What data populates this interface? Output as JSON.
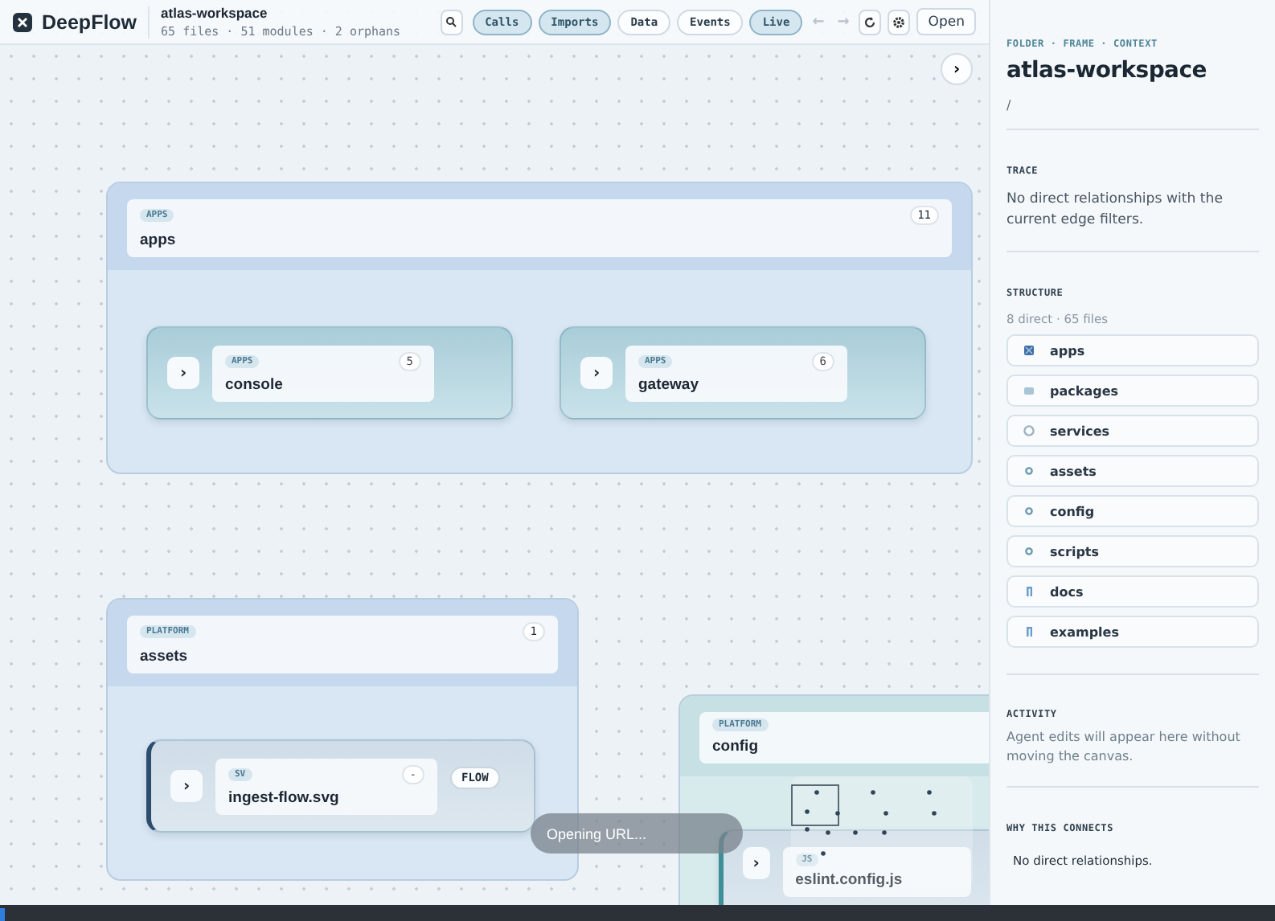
{
  "app": {
    "name": "DeepFlow",
    "workspace": "atlas-workspace",
    "summary": "65 files · 51 modules · 2 orphans"
  },
  "toolbar": {
    "filters": [
      {
        "label": "Calls",
        "selected": true
      },
      {
        "label": "Imports",
        "selected": true
      },
      {
        "label": "Data",
        "selected": false
      },
      {
        "label": "Events",
        "selected": false
      },
      {
        "label": "Live",
        "selected": true
      }
    ],
    "back": {
      "label": "←",
      "disabled": true
    },
    "forward": {
      "label": "→",
      "disabled": true
    },
    "open": "Open"
  },
  "canvas": {
    "groups": [
      {
        "tag": "APPS",
        "name": "apps",
        "count": "11",
        "children": [
          {
            "expander": "›",
            "tag": "APPS",
            "name": "console",
            "count": "5"
          },
          {
            "expander": "›",
            "tag": "APPS",
            "name": "gateway",
            "count": "6"
          }
        ]
      },
      {
        "tag": "PLATFORM",
        "name": "assets",
        "count": "1",
        "children": [
          {
            "expander": "›",
            "tag": "SV",
            "name": "ingest-flow.svg",
            "count": "-",
            "badge": "FLOW"
          }
        ]
      },
      {
        "tag": "PLATFORM",
        "name": "config",
        "children": [
          {
            "expander": "›",
            "tag": "JS",
            "name": "eslint.config.js"
          }
        ]
      }
    ],
    "collapse": "›",
    "toast": "Opening URL..."
  },
  "panel": {
    "breadcrumb": "FOLDER · FRAME · CONTEXT",
    "title": "atlas-workspace",
    "path": "/",
    "trace": {
      "heading": "TRACE",
      "text": "No direct relationships with the current edge filters."
    },
    "structure": {
      "heading": "STRUCTURE",
      "summary": "8 direct · 65 files",
      "items": [
        {
          "label": "apps",
          "kind": "app"
        },
        {
          "label": "packages",
          "kind": "package"
        },
        {
          "label": "services",
          "kind": "service"
        },
        {
          "label": "assets",
          "kind": "module"
        },
        {
          "label": "config",
          "kind": "module"
        },
        {
          "label": "scripts",
          "kind": "module"
        },
        {
          "label": "docs",
          "kind": "doc"
        },
        {
          "label": "examples",
          "kind": "doc"
        }
      ]
    },
    "activity": {
      "heading": "ACTIVITY",
      "text": "Agent edits will appear here without moving the canvas."
    },
    "why": {
      "heading": "WHY THIS CONNECTS",
      "text": "No direct relationships."
    }
  }
}
